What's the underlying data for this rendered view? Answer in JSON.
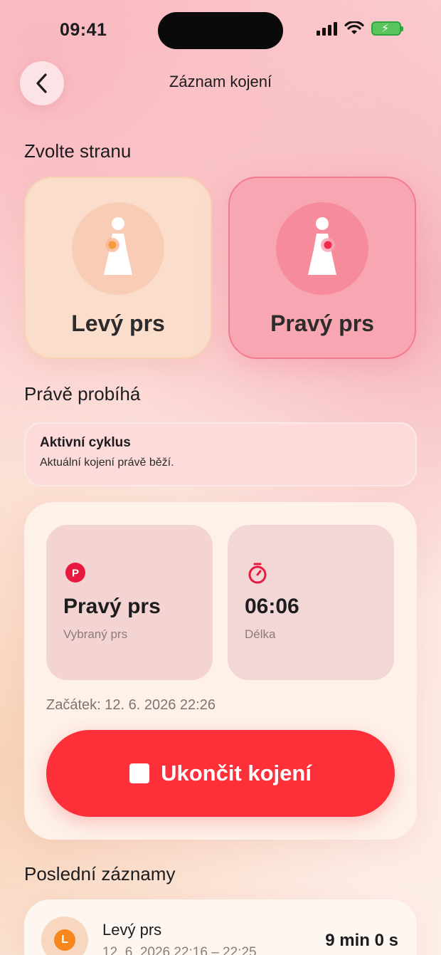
{
  "status_bar": {
    "time": "09:41"
  },
  "nav": {
    "title": "Záznam kojení"
  },
  "side_section": {
    "title": "Zvolte stranu",
    "left": {
      "label": "Levý prs"
    },
    "right": {
      "label": "Pravý prs"
    }
  },
  "current_section": {
    "title": "Právě probíhá",
    "banner_title": "Aktivní cyklus",
    "banner_subtitle": "Aktuální kojení právě běží.",
    "breast_badge": "P",
    "breast_value": "Pravý prs",
    "breast_label": "Vybraný prs",
    "duration_value": "06:06",
    "duration_label": "Délka",
    "start_text": "Začátek: 12. 6. 2026 22:26",
    "stop_label": "Ukončit kojení"
  },
  "recent_section": {
    "title": "Poslední záznamy",
    "items": [
      {
        "badge": "L",
        "title": "Levý prs",
        "subtitle": "12. 6. 2026 22:16 – 22:25",
        "duration": "9 min 0 s"
      }
    ]
  },
  "colors": {
    "accent": "#fd3039",
    "selected": "#f8a6b1",
    "left_accent": "#f7861e"
  }
}
